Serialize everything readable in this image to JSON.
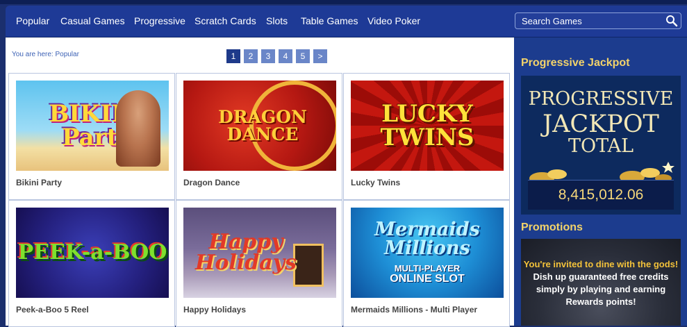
{
  "nav": {
    "items": [
      {
        "label": "Popular"
      },
      {
        "label": "Casual Games"
      },
      {
        "label": "Progressive"
      },
      {
        "label": "Scratch Cards"
      },
      {
        "label": "Slots"
      },
      {
        "label": "Table Games"
      },
      {
        "label": "Video Poker"
      }
    ]
  },
  "search": {
    "placeholder": "Search Games",
    "icon": "search-icon"
  },
  "breadcrumb": "You are here: Popular",
  "pager": {
    "pages": [
      "1",
      "2",
      "3",
      "4",
      "5",
      ">"
    ],
    "current": "1"
  },
  "games": [
    {
      "name": "Bikini Party",
      "art_title": "BIKINI Party"
    },
    {
      "name": "Dragon Dance",
      "art_title": "DRAGON DANCE"
    },
    {
      "name": "Lucky Twins",
      "art_title": "LUCKY TWINS"
    },
    {
      "name": "Peek-a-Boo 5 Reel",
      "art_title": "PEEK-a-BOO"
    },
    {
      "name": "Happy Holidays",
      "art_title": "Happy Holidays"
    },
    {
      "name": "Mermaids Millions - Multi Player",
      "art_title": "Mermaids Millions",
      "art_subtitle_1": "MULTI-PLAYER",
      "art_subtitle_2": "ONLINE SLOT"
    }
  ],
  "sidebar": {
    "jackpot_heading": "Progressive Jackpot",
    "jackpot_line1": "PROGRESSIVE",
    "jackpot_line2": "JACKPOT",
    "jackpot_line3": "TOTAL",
    "jackpot_amount": "8,415,012.06",
    "promotions_heading": "Promotions",
    "promo_line1": "You're invited to dine with the gods!",
    "promo_line2": "Dish up guaranteed free credits",
    "promo_line3": "simply by playing and earning",
    "promo_line4": "Rewards points!"
  },
  "colors": {
    "nav_bg": "#1e3a96",
    "sidebar_bg": "#1c3c8e",
    "accent_gold": "#f3d36a",
    "page_active": "#1e3a8a",
    "page_inactive": "#6a86c8"
  }
}
